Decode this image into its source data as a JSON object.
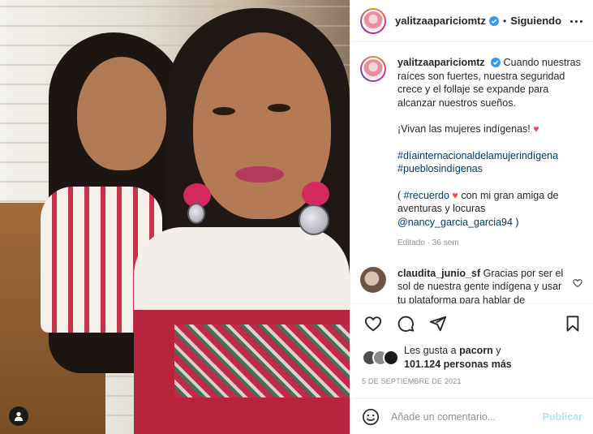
{
  "post": {
    "username": "yalitzaapariciomtz",
    "follow_state": "Siguiendo",
    "separator": "•"
  },
  "caption": {
    "username": "yalitzaapariciomtz",
    "text1": "Cuando nuestras raíces son fuertes, nuestra seguridad crece y el follaje se expande para alcanzar nuestros sueños.",
    "text2": "¡Vivan las mujeres indígenas!",
    "heart": "♥",
    "hashtag1": "#díainternacionaldelamujerindígena",
    "hashtag2": "#pueblosindígenas",
    "line3_open": "( ",
    "hashtag3": "#recuerdo",
    "heart2": "♥",
    "line3_rest": " con mi gran amiga de aventuras y locuras",
    "mention": "@nancy_garcia_garcia94",
    "line3_close": " )",
    "meta": "Editado · 36 sem"
  },
  "comment": {
    "username": "claudita_junio_sf",
    "text": "Gracias por ser el sol de nuestra gente indígena y usar tu plataforma para hablar de"
  },
  "likes": {
    "prefix": "Les gusta a",
    "user": "pacorn",
    "middle": " y",
    "count": "101.124 personas más"
  },
  "date": "5 DE SEPTIEMBRE DE 2021",
  "composer": {
    "placeholder": "Añade un comentario...",
    "post_label": "Publicar"
  },
  "colors": {
    "link": "#00376b",
    "heart": "#ed4956",
    "verified": "#3897f0",
    "post_disabled": "#b3dbff"
  }
}
